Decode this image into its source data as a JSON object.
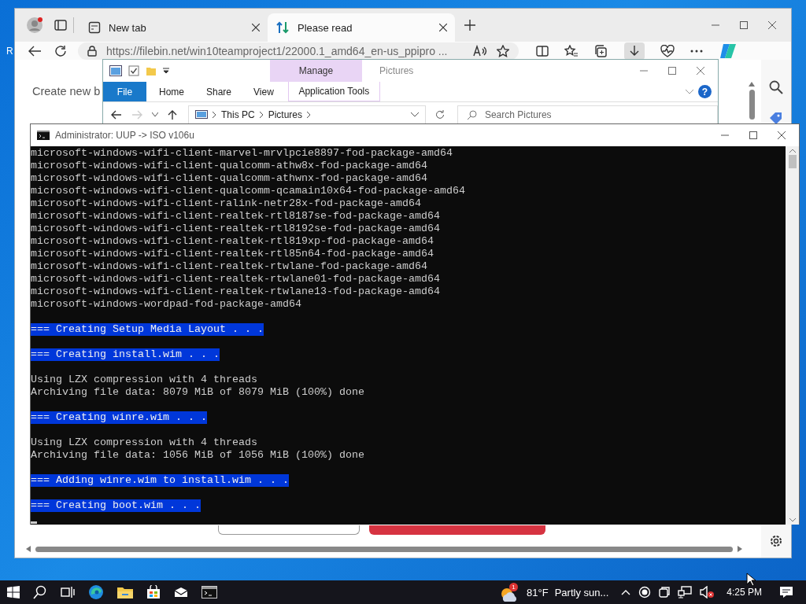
{
  "desktop": {
    "icon_labels": [
      "R"
    ]
  },
  "browser": {
    "tabs": [
      {
        "title": "New tab",
        "selected": false,
        "kind": "newtab"
      },
      {
        "title": "Please read",
        "selected": true,
        "kind": "transfer"
      }
    ],
    "url": "https://filebin.net/win10teamproject1/22000.1_amd64_en-us_ppipro ...",
    "page_heading": "Create new b"
  },
  "explorer": {
    "title": "Pictures",
    "context_tab": "Manage",
    "help_label": "?",
    "ribbon_tabs": [
      {
        "label": "File",
        "kind": "file"
      },
      {
        "label": "Home",
        "kind": "plain"
      },
      {
        "label": "Share",
        "kind": "plain"
      },
      {
        "label": "View",
        "kind": "plain"
      },
      {
        "label": "Application Tools",
        "kind": "context"
      }
    ],
    "path": [
      "This PC",
      "Pictures"
    ],
    "search_placeholder": "Search Pictures"
  },
  "console": {
    "title": "Administrator:  UUP -> ISO v106u",
    "lines": [
      {
        "kind": "output",
        "text": "microsoft-windows-wifi-client-marvel-mrvlpcie8897-fod-package-amd64"
      },
      {
        "kind": "output",
        "text": "microsoft-windows-wifi-client-qualcomm-athw8x-fod-package-amd64"
      },
      {
        "kind": "output",
        "text": "microsoft-windows-wifi-client-qualcomm-athwnx-fod-package-amd64"
      },
      {
        "kind": "output",
        "text": "microsoft-windows-wifi-client-qualcomm-qcamain10x64-fod-package-amd64"
      },
      {
        "kind": "output",
        "text": "microsoft-windows-wifi-client-ralink-netr28x-fod-package-amd64"
      },
      {
        "kind": "output",
        "text": "microsoft-windows-wifi-client-realtek-rtl8187se-fod-package-amd64"
      },
      {
        "kind": "output",
        "text": "microsoft-windows-wifi-client-realtek-rtl8192se-fod-package-amd64"
      },
      {
        "kind": "output",
        "text": "microsoft-windows-wifi-client-realtek-rtl819xp-fod-package-amd64"
      },
      {
        "kind": "output",
        "text": "microsoft-windows-wifi-client-realtek-rtl85n64-fod-package-amd64"
      },
      {
        "kind": "output",
        "text": "microsoft-windows-wifi-client-realtek-rtwlane-fod-package-amd64"
      },
      {
        "kind": "output",
        "text": "microsoft-windows-wifi-client-realtek-rtwlane01-fod-package-amd64"
      },
      {
        "kind": "output",
        "text": "microsoft-windows-wifi-client-realtek-rtwlane13-fod-package-amd64"
      },
      {
        "kind": "output",
        "text": "microsoft-windows-wordpad-fod-package-amd64"
      },
      {
        "kind": "blank"
      },
      {
        "kind": "banner",
        "text": "=== Creating Setup Media Layout . . ."
      },
      {
        "kind": "blank"
      },
      {
        "kind": "banner",
        "text": "=== Creating install.wim . . ."
      },
      {
        "kind": "blank"
      },
      {
        "kind": "output",
        "text": "Using LZX compression with 4 threads"
      },
      {
        "kind": "output",
        "text": "Archiving file data: 8079 MiB of 8079 MiB (100%) done"
      },
      {
        "kind": "blank"
      },
      {
        "kind": "banner",
        "text": "=== Creating winre.wim . . ."
      },
      {
        "kind": "blank"
      },
      {
        "kind": "output",
        "text": "Using LZX compression with 4 threads"
      },
      {
        "kind": "output",
        "text": "Archiving file data: 1056 MiB of 1056 MiB (100%) done"
      },
      {
        "kind": "blank"
      },
      {
        "kind": "banner",
        "text": "=== Adding winre.wim to install.wim . . ."
      },
      {
        "kind": "blank"
      },
      {
        "kind": "banner",
        "text": "=== Creating boot.wim . . ."
      },
      {
        "kind": "cursor"
      }
    ]
  },
  "taskbar": {
    "weather_badge": "1",
    "temperature": "81°F",
    "weather_summary": "Partly sun...",
    "time": "4:25 PM"
  }
}
